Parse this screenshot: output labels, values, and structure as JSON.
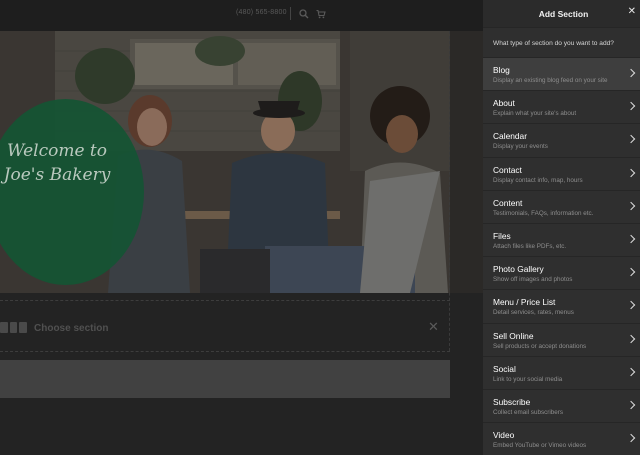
{
  "site": {
    "phone": "(480) 565-8800",
    "welcome": "Welcome to Joe's Bakery",
    "choose_section": "Choose section",
    "close_symbol": "✕"
  },
  "icons": {
    "search": "search-icon",
    "cart": "cart-icon",
    "section_grid": "grid-icon",
    "close": "close-icon",
    "chevron": "chevron-right-icon"
  },
  "panel": {
    "title": "Add Section",
    "close_symbol": "✕",
    "prompt": "What type of section do you want to add?",
    "items": [
      {
        "name": "Blog",
        "desc": "Display an existing blog feed on your site",
        "active": true
      },
      {
        "name": "About",
        "desc": "Explain what your site's about"
      },
      {
        "name": "Calendar",
        "desc": "Display your events"
      },
      {
        "name": "Contact",
        "desc": "Display contact info, map, hours"
      },
      {
        "name": "Content",
        "desc": "Testimonials, FAQs, information etc."
      },
      {
        "name": "Files",
        "desc": "Attach files like PDFs, etc."
      },
      {
        "name": "Photo Gallery",
        "desc": "Show off images and photos"
      },
      {
        "name": "Menu / Price List",
        "desc": "Detail services, rates, menus"
      },
      {
        "name": "Sell Online",
        "desc": "Sell products or accept donations"
      },
      {
        "name": "Social",
        "desc": "Link to your social media"
      },
      {
        "name": "Subscribe",
        "desc": "Collect email subscribers"
      },
      {
        "name": "Video",
        "desc": "Embed YouTube or Vimeo videos"
      }
    ]
  },
  "colors": {
    "panel_bg": "#2f2f2f",
    "active_item_bg": "#3e3e3e",
    "welcome_circle": "#145434"
  }
}
